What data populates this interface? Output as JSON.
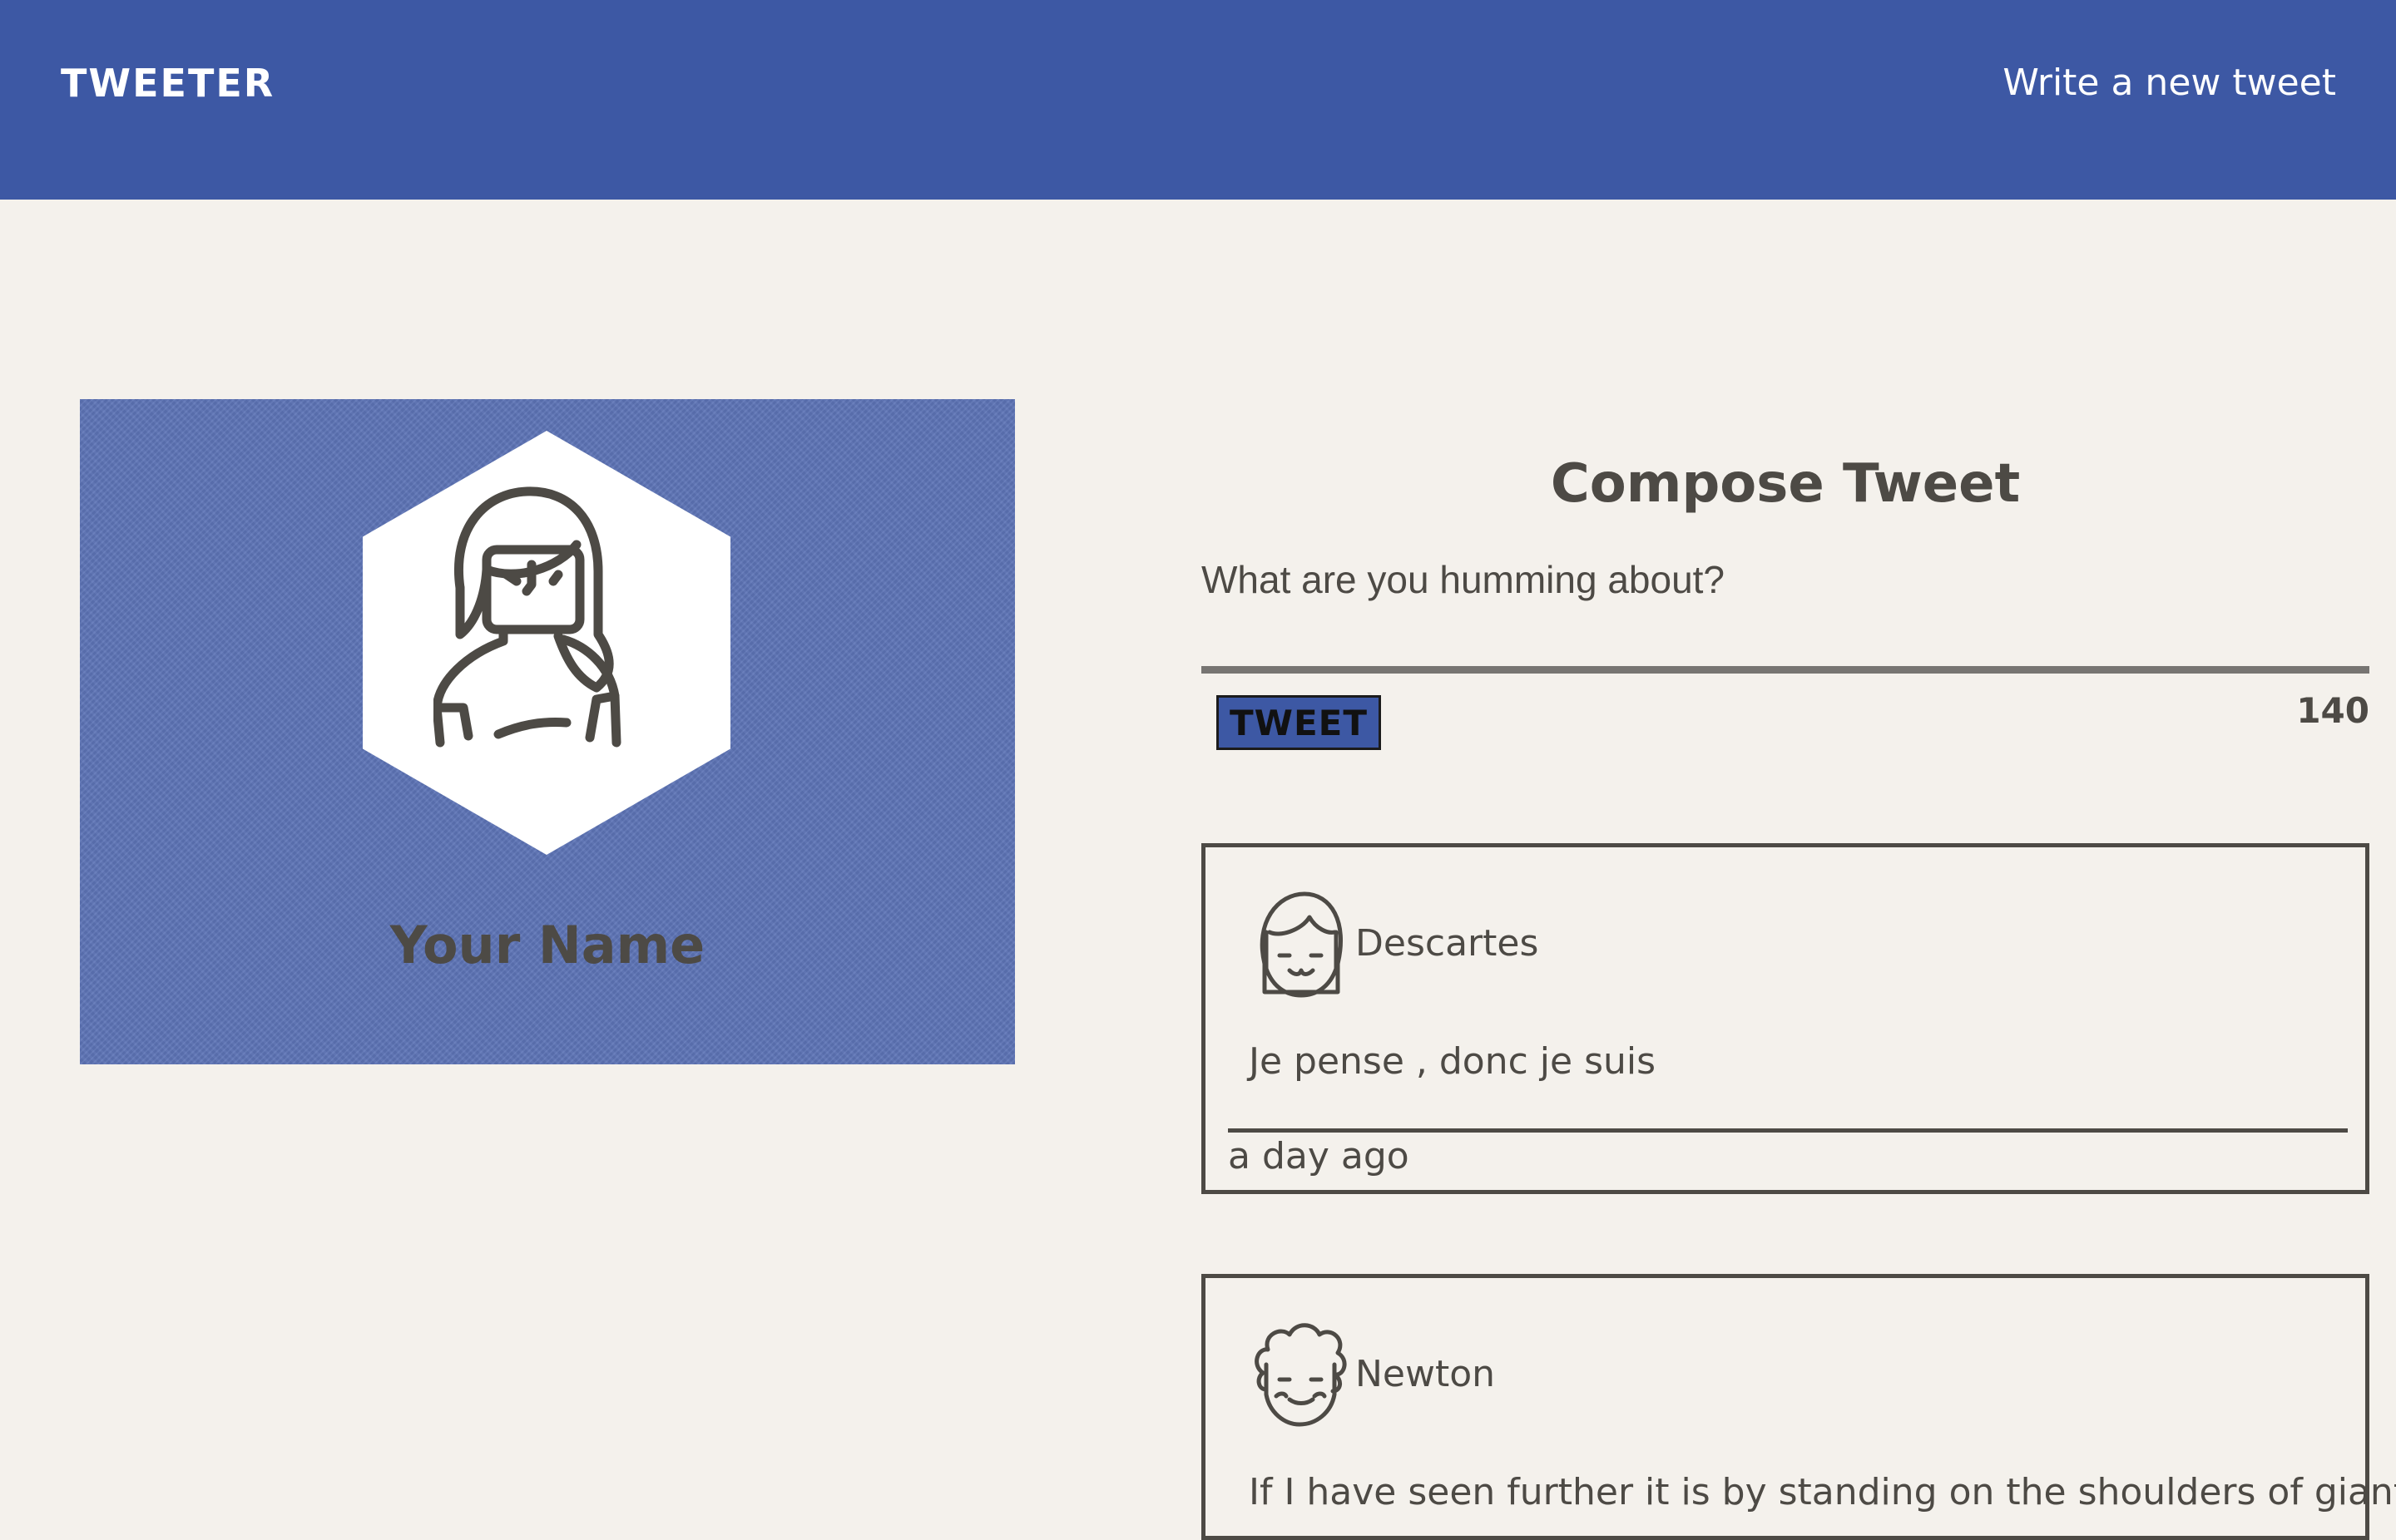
{
  "nav": {
    "brand": "TWEETER",
    "new_tweet_link": "Write a new tweet"
  },
  "profile": {
    "name": "Your Name"
  },
  "compose": {
    "title": "Compose Tweet",
    "placeholder": "What are you humming about?",
    "button_label": "TWEET",
    "char_counter": "140"
  },
  "tweets": [
    {
      "author": "Descartes",
      "content": "Je pense , donc je suis",
      "time": "a day ago"
    },
    {
      "author": "Newton",
      "content": "If I have seen further it is by standing on the shoulders of giants"
    }
  ],
  "colors": {
    "nav_background": "#3d58a4",
    "page_background": "#f4f1ec",
    "text": "#4d4a45",
    "profile_background": "#5d74b6"
  }
}
